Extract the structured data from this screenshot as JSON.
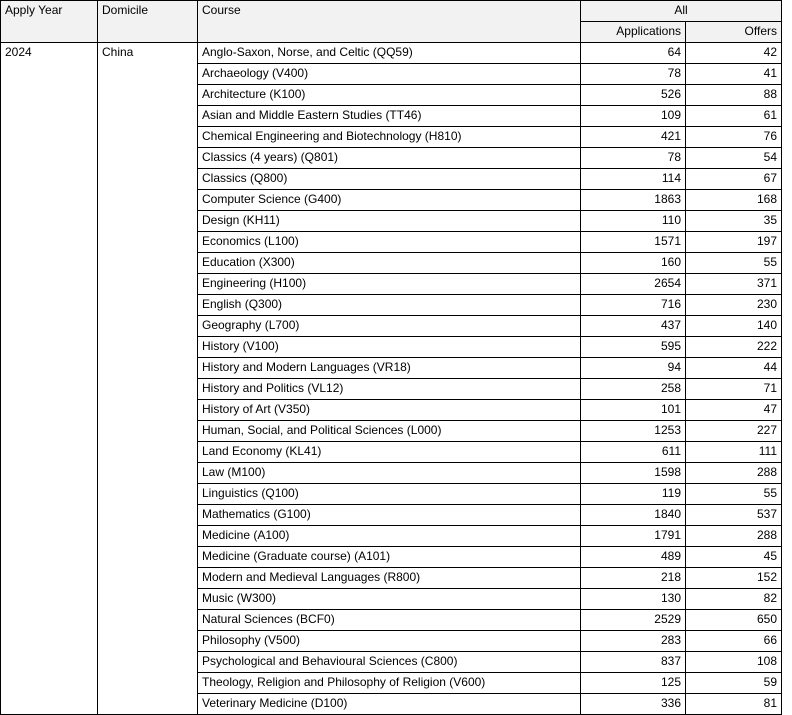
{
  "table": {
    "header": {
      "apply_year": "Apply Year",
      "domicile": "Domicile",
      "course": "Course",
      "group_all": "All",
      "applications": "Applications",
      "offers": "Offers"
    },
    "merged": {
      "apply_year_value": "2024",
      "domicile_value": "China"
    },
    "rows": [
      {
        "course": "Anglo-Saxon, Norse, and Celtic (QQ59)",
        "applications": "64",
        "offers": "42"
      },
      {
        "course": "Archaeology (V400)",
        "applications": "78",
        "offers": "41"
      },
      {
        "course": "Architecture (K100)",
        "applications": "526",
        "offers": "88"
      },
      {
        "course": "Asian and Middle Eastern Studies (TT46)",
        "applications": "109",
        "offers": "61"
      },
      {
        "course": "Chemical Engineering and Biotechnology (H810)",
        "applications": "421",
        "offers": "76"
      },
      {
        "course": "Classics (4 years) (Q801)",
        "applications": "78",
        "offers": "54"
      },
      {
        "course": "Classics (Q800)",
        "applications": "114",
        "offers": "67"
      },
      {
        "course": "Computer Science (G400)",
        "applications": "1863",
        "offers": "168"
      },
      {
        "course": "Design (KH11)",
        "applications": "110",
        "offers": "35"
      },
      {
        "course": "Economics (L100)",
        "applications": "1571",
        "offers": "197"
      },
      {
        "course": "Education (X300)",
        "applications": "160",
        "offers": "55"
      },
      {
        "course": "Engineering (H100)",
        "applications": "2654",
        "offers": "371"
      },
      {
        "course": "English (Q300)",
        "applications": "716",
        "offers": "230"
      },
      {
        "course": "Geography (L700)",
        "applications": "437",
        "offers": "140"
      },
      {
        "course": "History (V100)",
        "applications": "595",
        "offers": "222"
      },
      {
        "course": "History and Modern Languages (VR18)",
        "applications": "94",
        "offers": "44"
      },
      {
        "course": "History and Politics (VL12)",
        "applications": "258",
        "offers": "71"
      },
      {
        "course": "History of Art (V350)",
        "applications": "101",
        "offers": "47"
      },
      {
        "course": "Human, Social, and Political Sciences (L000)",
        "applications": "1253",
        "offers": "227"
      },
      {
        "course": "Land Economy (KL41)",
        "applications": "611",
        "offers": "111"
      },
      {
        "course": "Law (M100)",
        "applications": "1598",
        "offers": "288"
      },
      {
        "course": "Linguistics (Q100)",
        "applications": "119",
        "offers": "55"
      },
      {
        "course": "Mathematics (G100)",
        "applications": "1840",
        "offers": "537"
      },
      {
        "course": "Medicine (A100)",
        "applications": "1791",
        "offers": "288"
      },
      {
        "course": "Medicine (Graduate course) (A101)",
        "applications": "489",
        "offers": "45"
      },
      {
        "course": "Modern and Medieval Languages (R800)",
        "applications": "218",
        "offers": "152"
      },
      {
        "course": "Music (W300)",
        "applications": "130",
        "offers": "82"
      },
      {
        "course": "Natural Sciences (BCF0)",
        "applications": "2529",
        "offers": "650"
      },
      {
        "course": "Philosophy (V500)",
        "applications": "283",
        "offers": "66"
      },
      {
        "course": "Psychological and Behavioural Sciences (C800)",
        "applications": "837",
        "offers": "108"
      },
      {
        "course": "Theology, Religion and Philosophy of Religion (V600)",
        "applications": "125",
        "offers": "59"
      },
      {
        "course": "Veterinary Medicine (D100)",
        "applications": "336",
        "offers": "81"
      }
    ]
  }
}
